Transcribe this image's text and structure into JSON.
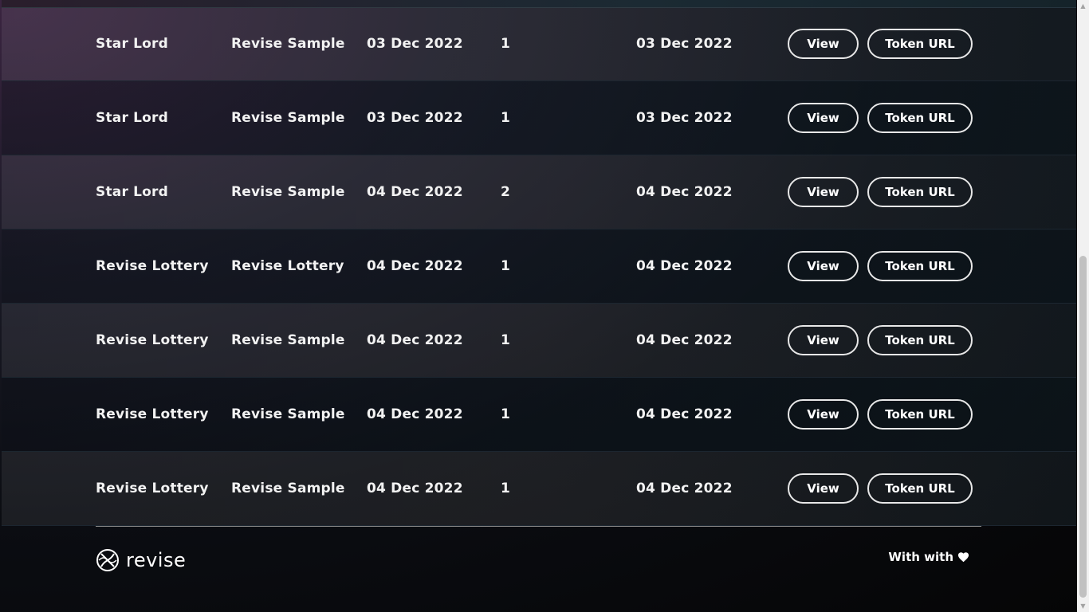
{
  "rows": [
    {
      "name": "Star Lord",
      "project": "Revise Sample",
      "created": "03 Dec 2022",
      "count": "1",
      "updated": "03 Dec 2022",
      "view_label": "View",
      "token_label": "Token URL"
    },
    {
      "name": "Star Lord",
      "project": "Revise Sample",
      "created": "03 Dec 2022",
      "count": "1",
      "updated": "03 Dec 2022",
      "view_label": "View",
      "token_label": "Token URL"
    },
    {
      "name": "Star Lord",
      "project": "Revise Sample",
      "created": "04 Dec 2022",
      "count": "2",
      "updated": "04 Dec 2022",
      "view_label": "View",
      "token_label": "Token URL"
    },
    {
      "name": "Revise Lottery",
      "project": "Revise Lottery",
      "created": "04 Dec 2022",
      "count": "1",
      "updated": "04 Dec 2022",
      "view_label": "View",
      "token_label": "Token URL"
    },
    {
      "name": "Revise Lottery",
      "project": "Revise Sample",
      "created": "04 Dec 2022",
      "count": "1",
      "updated": "04 Dec 2022",
      "view_label": "View",
      "token_label": "Token URL"
    },
    {
      "name": "Revise Lottery",
      "project": "Revise Sample",
      "created": "04 Dec 2022",
      "count": "1",
      "updated": "04 Dec 2022",
      "view_label": "View",
      "token_label": "Token URL"
    },
    {
      "name": "Revise Lottery",
      "project": "Revise Sample",
      "created": "04 Dec 2022",
      "count": "1",
      "updated": "04 Dec 2022",
      "view_label": "View",
      "token_label": "Token URL"
    }
  ],
  "footer": {
    "logo_text": "revise",
    "logo_icon": "revise-logo-icon",
    "made_with": "With with",
    "heart_icon": "heart-icon"
  },
  "colors": {
    "button_border": "#e8e8e8",
    "text": "#f2f2f2"
  }
}
